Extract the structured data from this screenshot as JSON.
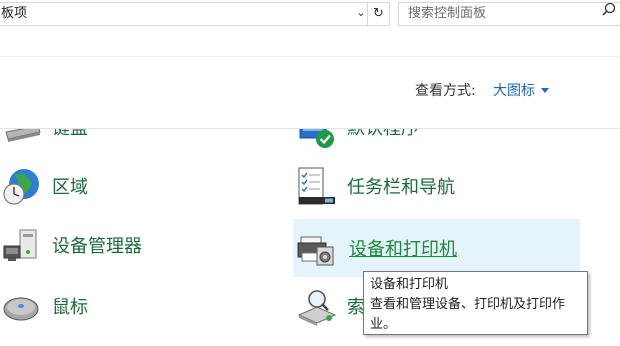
{
  "address": {
    "path_text": "板项"
  },
  "search": {
    "placeholder": "搜索控制面板"
  },
  "view": {
    "label": "查看方式:",
    "value": "大图标"
  },
  "items": {
    "keyboard": "键盘",
    "default_programs": "默认程序",
    "region": "区域",
    "taskbar": "任务栏和导航",
    "device_manager": "设备管理器",
    "devices_printers": "设备和打印机",
    "mouse": "鼠标",
    "indexing": "索"
  },
  "tooltip": {
    "title": "设备和打印机",
    "description": "查看和管理设备、打印机及打印作业。"
  },
  "colors": {
    "link": "#1a6b3a",
    "accent": "#1a66c7",
    "hover_bg": "#e5f3fb"
  }
}
